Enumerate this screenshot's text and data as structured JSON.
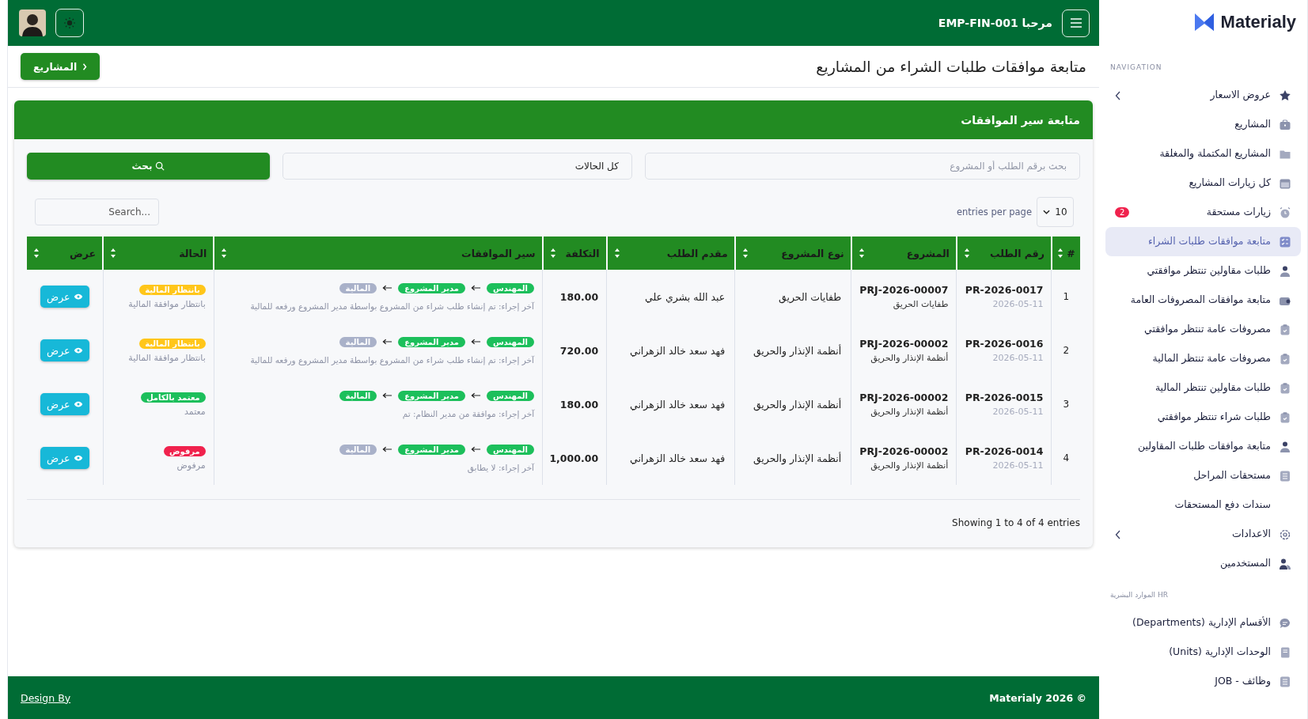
{
  "topbar": {
    "greeting": "مرحبا EMP-FIN-001"
  },
  "page": {
    "title": "متابعة موافقات طلبات الشراء من المشاريع",
    "back_button": "المشاريع"
  },
  "card": {
    "title": "متابعة سير الموافقات",
    "search": {
      "placeholder": "بحث برقم الطلب أو المشروع"
    },
    "status_filter": {
      "value": "كل الحالات"
    },
    "search_button": "بحث",
    "page_size": "10",
    "page_size_label": "entries per page",
    "table_search": {
      "placeholder": "Search..."
    }
  },
  "table": {
    "columns": [
      "#",
      "رقم الطلب",
      "المشروع",
      "نوع المشروع",
      "مقدم الطلب",
      "التكلفة",
      "سير الموافقات",
      "الحالة",
      "عرض"
    ],
    "rows": [
      {
        "index": "1",
        "request": "PR-2026-0017",
        "date": "2026-05-11",
        "project": "PRJ-2026-00007",
        "project_name": "طفايات الحريق",
        "type": "طفايات الحريق",
        "requester": "عبد الله بشري علي",
        "cost": "180.00",
        "steps": [
          {
            "label": "المهندس",
            "done": true
          },
          {
            "label": "مدير المشروع",
            "done": true
          },
          {
            "label": "المالية",
            "done": false
          }
        ],
        "last_action": "آخر إجراء: تم إنشاء طلب شراء من المشروع بواسطة مدير المشروع ورفعه للمالية",
        "status": {
          "label": "بانتظار المالية",
          "color": "#ffc61a"
        },
        "status_note": "بانتظار موافقة المالية",
        "action": "عرض"
      },
      {
        "index": "2",
        "request": "PR-2026-0016",
        "date": "2026-05-11",
        "project": "PRJ-2026-00002",
        "project_name": "أنظمة الإنذار والحريق",
        "type": "أنظمة الإنذار والحريق",
        "requester": "فهد سعد خالد الزهراني",
        "cost": "720.00",
        "steps": [
          {
            "label": "المهندس",
            "done": true
          },
          {
            "label": "مدير المشروع",
            "done": true
          },
          {
            "label": "المالية",
            "done": false
          }
        ],
        "last_action": "آخر إجراء: تم إنشاء طلب شراء من المشروع بواسطة مدير المشروع ورفعه للمالية",
        "status": {
          "label": "بانتظار المالية",
          "color": "#ffc61a"
        },
        "status_note": "بانتظار موافقة المالية",
        "action": "عرض"
      },
      {
        "index": "3",
        "request": "PR-2026-0015",
        "date": "2026-05-11",
        "project": "PRJ-2026-00002",
        "project_name": "أنظمة الإنذار والحريق",
        "type": "أنظمة الإنذار والحريق",
        "requester": "فهد سعد خالد الزهراني",
        "cost": "180.00",
        "steps": [
          {
            "label": "المهندس",
            "done": true
          },
          {
            "label": "مدير المشروع",
            "done": true
          },
          {
            "label": "المالية",
            "done": true
          }
        ],
        "last_action": "آخر إجراء: موافقة من مدير النظام: تم",
        "status": {
          "label": "معتمد بالكامل",
          "color": "#1cbf5b"
        },
        "status_note": "معتمد",
        "action": "عرض"
      },
      {
        "index": "4",
        "request": "PR-2026-0014",
        "date": "2026-05-11",
        "project": "PRJ-2026-00002",
        "project_name": "أنظمة الإنذار والحريق",
        "type": "أنظمة الإنذار والحريق",
        "requester": "فهد سعد خالد الزهراني",
        "cost": "1,000.00",
        "steps": [
          {
            "label": "المهندس",
            "done": true
          },
          {
            "label": "مدير المشروع",
            "done": true
          },
          {
            "label": "المالية",
            "done": false
          }
        ],
        "last_action": "آخر إجراء: لا يطابق",
        "status": {
          "label": "مرفوض",
          "color": "#f0224d"
        },
        "status_note": "مرفوض",
        "action": "عرض"
      }
    ],
    "info": "Showing 1 to 4 of 4 entries"
  },
  "sidebar": {
    "logo": "Materialy",
    "sections": [
      {
        "title": "NAVIGATION",
        "items": [
          {
            "label": "عروض الاسعار",
            "kind": "submenu",
            "selected": false
          },
          {
            "label": "المشاريع",
            "kind": "link",
            "selected": false
          },
          {
            "label": "المشاريع المكتملة والمغلقة",
            "kind": "link",
            "selected": false
          },
          {
            "label": "كل زيارات المشاريع",
            "kind": "link",
            "selected": false
          },
          {
            "label": "زيارات مستحقة",
            "kind": "link",
            "selected": false,
            "badge": "2"
          },
          {
            "label": "متابعة موافقات طلبات الشراء",
            "kind": "link",
            "selected": true
          },
          {
            "label": "طلبات مقاولين تنتظر موافقتي",
            "kind": "link",
            "selected": false
          },
          {
            "label": "متابعة موافقات المصروفات العامة",
            "kind": "link",
            "selected": false
          },
          {
            "label": "مصروفات عامة تنتظر موافقتي",
            "kind": "link",
            "selected": false
          },
          {
            "label": "مصروفات عامة تنتظر المالية",
            "kind": "link",
            "selected": false
          },
          {
            "label": "طلبات مقاولين تنتظر المالية",
            "kind": "link",
            "selected": false
          },
          {
            "label": "طلبات شراء تنتظر موافقتي",
            "kind": "link",
            "selected": false
          },
          {
            "label": "متابعة موافقات طلبات المقاولين",
            "kind": "link",
            "selected": false
          },
          {
            "label": "مستحقات المراحل",
            "kind": "link",
            "selected": false
          },
          {
            "label": "سندات دفع المستحقات",
            "kind": "link",
            "selected": false
          },
          {
            "label": "الاعدادات",
            "kind": "submenu",
            "selected": false
          },
          {
            "label": "المستخدمين",
            "kind": "link",
            "selected": false
          }
        ]
      },
      {
        "title": "HR الموارد البشرية",
        "items": [
          {
            "label": "الأقسام الإدارية (Departments)",
            "kind": "link",
            "selected": false
          },
          {
            "label": "الوحدات الإدارية (Units)",
            "kind": "link",
            "selected": false
          },
          {
            "label": "وظائف - JOB",
            "kind": "link",
            "selected": false
          }
        ]
      }
    ]
  },
  "footer": {
    "copyright": "Materialy 2026 ©",
    "credit": "Design By"
  }
}
